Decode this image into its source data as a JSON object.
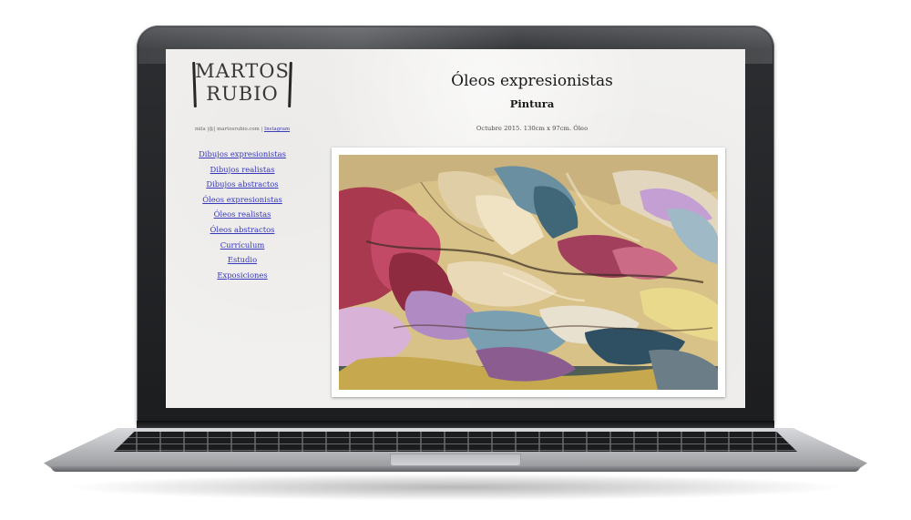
{
  "site": {
    "logo_lines": [
      "MARTOS",
      "RUBIO"
    ],
    "contact": {
      "text": "mila |@| martosrubio.com | ",
      "link_label": "Instagram"
    },
    "nav": [
      {
        "label": "Dibujos expresionistas"
      },
      {
        "label": "Dibujos realistas"
      },
      {
        "label": "Dibujos abstractos"
      },
      {
        "label": "Óleos expresionistas"
      },
      {
        "label": "Óleos realistas"
      },
      {
        "label": "Óleos abstractos"
      },
      {
        "label": "Currículum"
      },
      {
        "label": "Estudio"
      },
      {
        "label": "Exposiciones"
      }
    ]
  },
  "main": {
    "title": "Óleos expresionistas",
    "subtitle": "Pintura",
    "caption": "Octubre 2015. 130cm x 97cm. Óleo"
  },
  "colors": {
    "link": "#3636b8",
    "page_background": "#f1f0ee",
    "laptop_bezel": "#1c1d1f"
  }
}
